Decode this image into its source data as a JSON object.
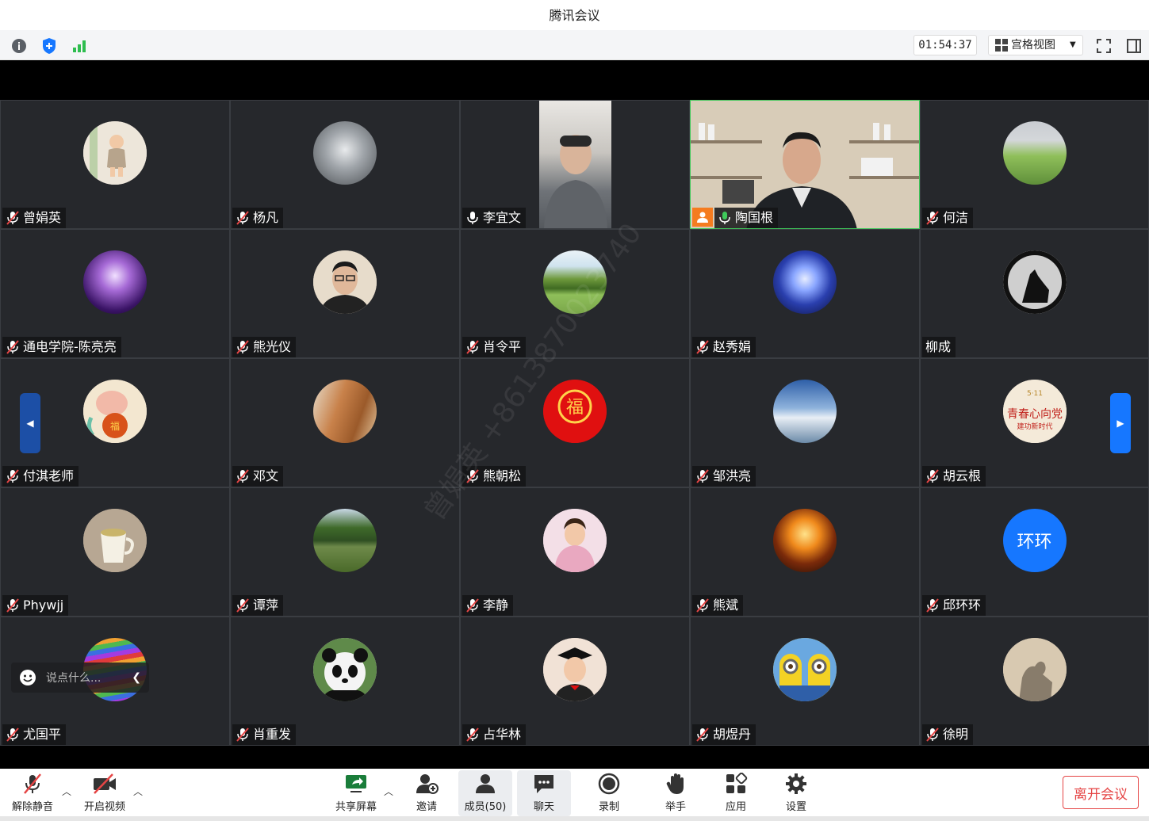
{
  "window": {
    "title": "腾讯会议"
  },
  "toolbar": {
    "timer": "01:54:37",
    "view_mode": "宫格视图"
  },
  "participants": [
    {
      "name": "曾娟英",
      "mic": "muted",
      "avatar": "photo-baby",
      "color": "#e8dfd2"
    },
    {
      "name": "杨凡",
      "mic": "muted",
      "avatar": "photo-sculpture",
      "color": "#8a8f95"
    },
    {
      "name": "李宜文",
      "mic": "on",
      "avatar": "video",
      "color": "#c8c5c0"
    },
    {
      "name": "陶国根",
      "mic": "speaking",
      "avatar": "video-bookshelf",
      "color": "#b9aa95",
      "host": true
    },
    {
      "name": "何洁",
      "mic": "muted",
      "avatar": "photo-grass",
      "color": "#6f9b4c"
    },
    {
      "name": "通电学院-陈亮亮",
      "mic": "muted",
      "avatar": "photo-purple",
      "color": "#5b2a8a"
    },
    {
      "name": "熊光仪",
      "mic": "muted",
      "avatar": "photo-man",
      "color": "#d9cbb7"
    },
    {
      "name": "肖令平",
      "mic": "muted",
      "avatar": "photo-tree",
      "color": "#7fa652"
    },
    {
      "name": "赵秀娟",
      "mic": "muted",
      "avatar": "photo-jellyfish",
      "color": "#2a3fae"
    },
    {
      "name": "柳成",
      "mic": "none",
      "avatar": "photo-wolf",
      "color": "#bfbfbf"
    },
    {
      "name": "付淇老师",
      "mic": "muted",
      "avatar": "photo-cartoon",
      "color": "#f3e7d0"
    },
    {
      "name": "邓文",
      "mic": "muted",
      "avatar": "photo-canyon",
      "color": "#b27a4a"
    },
    {
      "name": "熊朝松",
      "mic": "muted",
      "avatar": "photo-fu",
      "color": "#e01010"
    },
    {
      "name": "邹洪亮",
      "mic": "muted",
      "avatar": "photo-sky",
      "color": "#4d7fbf"
    },
    {
      "name": "胡云根",
      "mic": "muted",
      "avatar": "photo-poster",
      "color": "#f2e6d6"
    },
    {
      "name": "Phywjj",
      "mic": "muted",
      "avatar": "photo-cup",
      "color": "#b7a793"
    },
    {
      "name": "谭萍",
      "mic": "muted",
      "avatar": "photo-lake",
      "color": "#5d7a45"
    },
    {
      "name": "李静",
      "mic": "muted",
      "avatar": "photo-girl",
      "color": "#e7c3d1"
    },
    {
      "name": "熊斌",
      "mic": "muted",
      "avatar": "photo-explosion",
      "color": "#d9731f"
    },
    {
      "name": "邱环环",
      "mic": "muted",
      "avatar": "text",
      "avatar_text": "环环",
      "color": "#1677ff"
    },
    {
      "name": "尤国平",
      "mic": "muted",
      "avatar": "photo-stripes",
      "color": "#8b3fb5"
    },
    {
      "name": "肖重发",
      "mic": "muted",
      "avatar": "photo-panda",
      "color": "#eaeaea"
    },
    {
      "name": "占华林",
      "mic": "muted",
      "avatar": "photo-kid",
      "color": "#f1e2d6"
    },
    {
      "name": "胡煜丹",
      "mic": "muted",
      "avatar": "photo-minions",
      "color": "#f3d224"
    },
    {
      "name": "徐明",
      "mic": "muted",
      "avatar": "photo-shadow",
      "color": "#d8c9b1"
    }
  ],
  "watermark": "曾娟英 +8613870023740",
  "chat": {
    "placeholder": "说点什么..."
  },
  "bottom": {
    "unmute": "解除静音",
    "video": "开启视频",
    "share": "共享屏幕",
    "invite": "邀请",
    "members": "成员(50)",
    "chat": "聊天",
    "record": "录制",
    "raise_hand": "举手",
    "apps": "应用",
    "settings": "设置",
    "leave": "离开会议"
  },
  "colors": {
    "accent": "#1677ff",
    "leave": "#e54545",
    "speaking": "#3fc95a",
    "tile_bg": "#26282c"
  }
}
